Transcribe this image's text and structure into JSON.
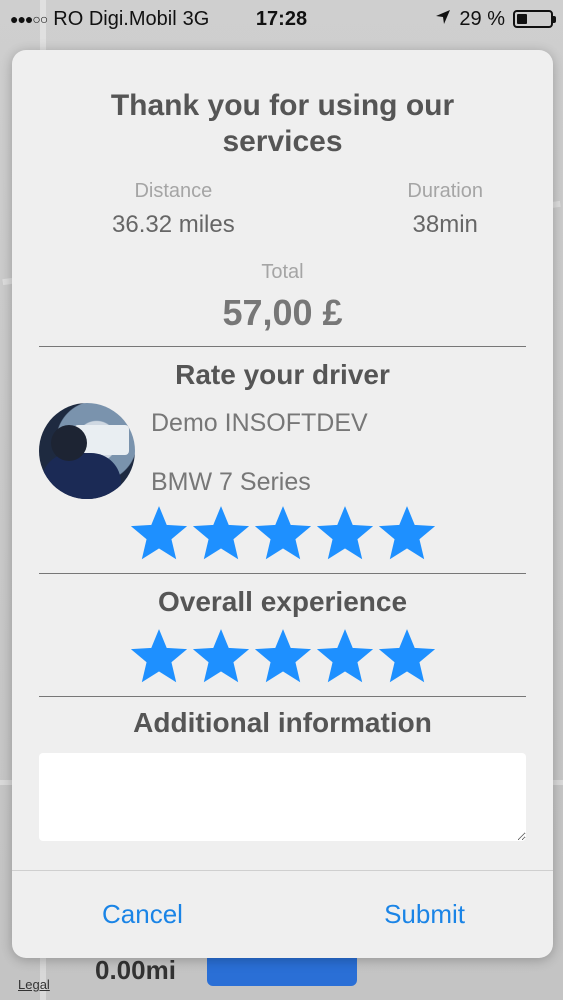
{
  "status_bar": {
    "carrier": "RO Digi.Mobil",
    "network": "3G",
    "time": "17:28",
    "battery_percent_text": "29 %",
    "battery_level": 0.29
  },
  "background": {
    "legal_label": "Legal",
    "value": "0.00mi"
  },
  "dialog": {
    "title": "Thank you for using our services",
    "distance": {
      "label": "Distance",
      "value": "36.32 miles"
    },
    "duration": {
      "label": "Duration",
      "value": "38min"
    },
    "total": {
      "label": "Total",
      "value": "57,00 £"
    },
    "driver_section": {
      "title": "Rate your driver",
      "name": "Demo INSOFTDEV",
      "car": "BMW 7 Series",
      "rating": 5,
      "max_rating": 5
    },
    "experience_section": {
      "title": "Overall experience",
      "rating": 5,
      "max_rating": 5
    },
    "additional": {
      "title": "Additional information",
      "value": ""
    },
    "actions": {
      "cancel_label": "Cancel",
      "submit_label": "Submit"
    }
  },
  "colors": {
    "star": "#1e90ff",
    "accent": "#1a84e6"
  }
}
